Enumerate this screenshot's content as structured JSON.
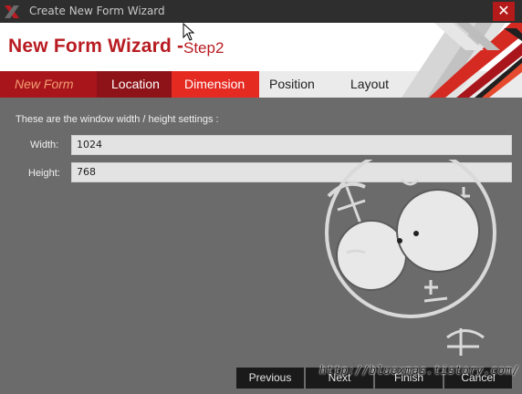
{
  "window": {
    "title": "Create New Form Wizard",
    "close_glyph": "✕"
  },
  "header": {
    "title": "New Form Wizard -",
    "step": "Step2"
  },
  "tabs": [
    {
      "label": "New Form",
      "state": "done"
    },
    {
      "label": "Location",
      "state": "done"
    },
    {
      "label": "Dimension",
      "state": "active"
    },
    {
      "label": "Position",
      "state": "pending"
    },
    {
      "label": "Layout",
      "state": "pending"
    }
  ],
  "main": {
    "description": "These are the window width / height settings :",
    "fields": [
      {
        "label": "Width:",
        "value": "1024"
      },
      {
        "label": "Height:",
        "value": "768"
      }
    ]
  },
  "footer": {
    "buttons": [
      "Previous",
      "Next",
      "Finish",
      "Cancel"
    ],
    "watermark": "http://bluexmas.tistory.com/"
  },
  "colors": {
    "accent_red": "#b81c22",
    "active_tab": "#e52a22",
    "titlebar": "#2e2e2e",
    "body_bg": "#6b6b6b"
  },
  "icons": [
    "app-logo-icon",
    "close-icon",
    "mouse-cursor-icon"
  ]
}
